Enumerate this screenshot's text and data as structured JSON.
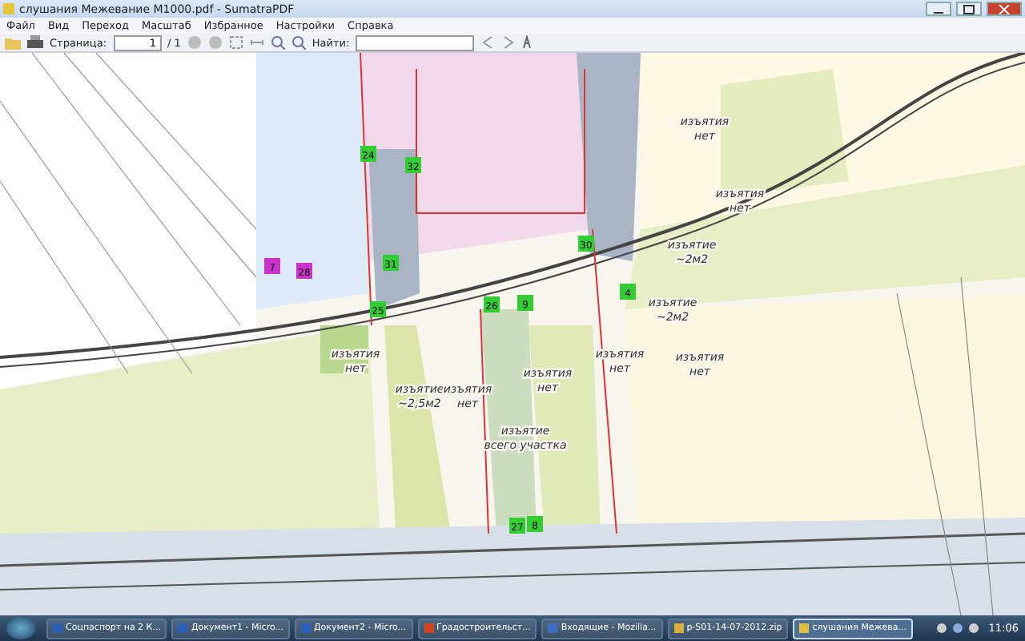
{
  "window": {
    "title": "слушания Межевание М1000.pdf - SumatraPDF"
  },
  "menu": [
    "Файл",
    "Вид",
    "Переход",
    "Масштаб",
    "Избранное",
    "Настройки",
    "Справка"
  ],
  "toolbar": {
    "page_label": "Страница:",
    "page_value": "1",
    "page_total": "/ 1",
    "find_label": "Найти:"
  },
  "map": {
    "labels": [
      {
        "lines": [
          "изъятия",
          "нет"
        ]
      },
      {
        "lines": [
          "изъятия",
          "нет"
        ]
      },
      {
        "lines": [
          "изъятие",
          "~2м2"
        ]
      },
      {
        "lines": [
          "изъятие",
          "~2м2"
        ]
      },
      {
        "lines": [
          "изъятия",
          "нет"
        ]
      },
      {
        "lines": [
          "изъятие",
          "~2,5м2"
        ]
      },
      {
        "lines": [
          "изъятия",
          "нет"
        ]
      },
      {
        "lines": [
          "изъятия",
          "нет"
        ]
      },
      {
        "lines": [
          "изъятия",
          "нет"
        ]
      },
      {
        "lines": [
          "изъятия",
          "нет"
        ]
      },
      {
        "lines": [
          "изъятие",
          "всего участка"
        ]
      }
    ],
    "markers": [
      {
        "text": "24",
        "color": "#33cc33"
      },
      {
        "text": "32",
        "color": "#33cc33"
      },
      {
        "text": "31",
        "color": "#33cc33"
      },
      {
        "text": "30",
        "color": "#33cc33"
      },
      {
        "text": "25",
        "color": "#33cc33"
      },
      {
        "text": "26",
        "color": "#33cc33"
      },
      {
        "text": "9",
        "color": "#33cc33"
      },
      {
        "text": "4",
        "color": "#33cc33"
      },
      {
        "text": "27",
        "color": "#33cc33"
      },
      {
        "text": "8",
        "color": "#33cc33"
      },
      {
        "text": "7",
        "color": "#cc33cc"
      },
      {
        "text": "28",
        "color": "#cc33cc"
      }
    ]
  },
  "taskbar": {
    "items": [
      {
        "label": "Соцпаспорт на 2 К...",
        "selected": false
      },
      {
        "label": "Документ1 - Micro...",
        "selected": false
      },
      {
        "label": "Документ2 - Micro...",
        "selected": false
      },
      {
        "label": "Градостроительст...",
        "selected": false
      },
      {
        "label": "Входящие - Mozilla...",
        "selected": false
      },
      {
        "label": "p-S01-14-07-2012.zip",
        "selected": false
      },
      {
        "label": "слушания Межева...",
        "selected": true
      }
    ],
    "clock": "11:06"
  }
}
